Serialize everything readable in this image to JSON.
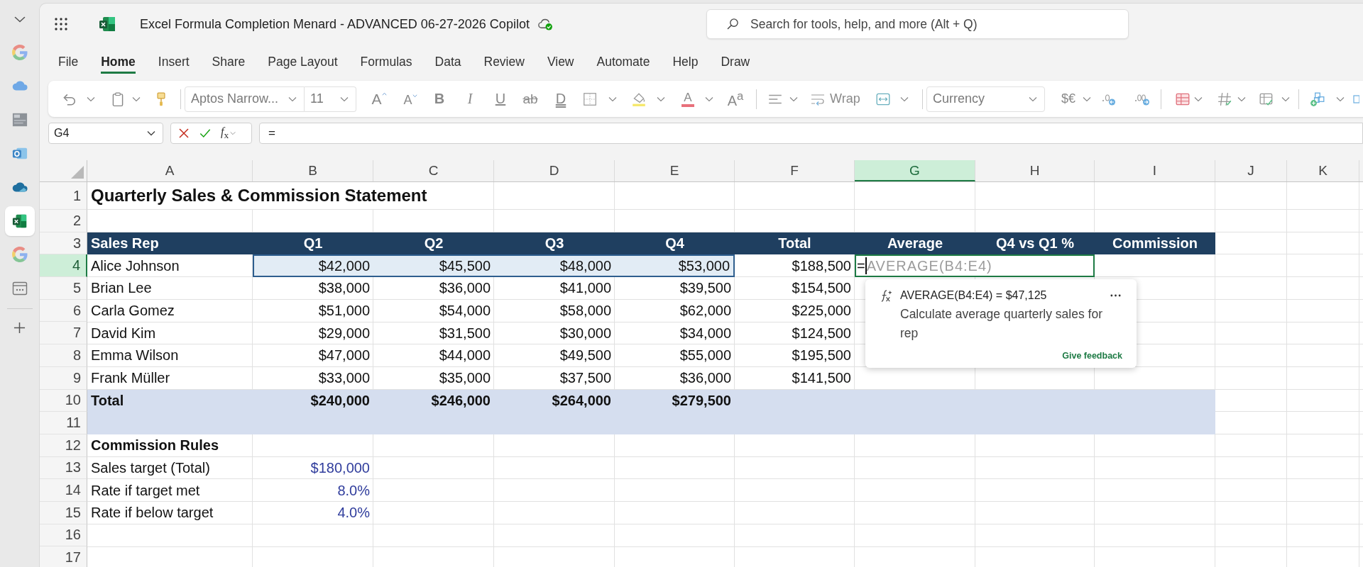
{
  "app_rail": {
    "apps": [
      {
        "selected": false
      },
      {
        "selected": false
      },
      {
        "selected": false
      },
      {
        "selected": false
      },
      {
        "selected": false
      },
      {
        "selected": true
      },
      {
        "selected": false
      },
      {
        "selected": false
      }
    ]
  },
  "title_bar": {
    "title": "Excel Formula Completion Menard - ADVANCED 06-27-2026 Copilot",
    "search": {
      "placeholder": "Search for tools, help, and more (Alt + Q)"
    }
  },
  "ribbon_tabs": [
    {
      "label": "File",
      "selected": false
    },
    {
      "label": "Home",
      "selected": true
    },
    {
      "label": "Insert",
      "selected": false
    },
    {
      "label": "Share",
      "selected": false
    },
    {
      "label": "Page Layout",
      "selected": false
    },
    {
      "label": "Formulas",
      "selected": false
    },
    {
      "label": "Data",
      "selected": false
    },
    {
      "label": "Review",
      "selected": false
    },
    {
      "label": "View",
      "selected": false
    },
    {
      "label": "Automate",
      "selected": false
    },
    {
      "label": "Help",
      "selected": false
    },
    {
      "label": "Draw",
      "selected": false
    }
  ],
  "ribbon": {
    "font_name": "Aptos Narrow...",
    "font_size": "11",
    "grow_font": "A",
    "shrink_font": "A",
    "bold": "B",
    "italic": "I",
    "underline": "U",
    "strikethrough": "ab",
    "double_underline": "D",
    "font_color": "A",
    "text_effects": "A$^{a}$",
    "wrap": "Wrap",
    "number_format": "Currency",
    "currency_symbols": "$€"
  },
  "formula_bar": {
    "name_box": "G4",
    "function_button": "*f*$_{x}$",
    "formula": "="
  },
  "sheet": {
    "columns": [
      {
        "label": "A",
        "selected": false
      },
      {
        "label": "B",
        "selected": false
      },
      {
        "label": "C",
        "selected": false
      },
      {
        "label": "D",
        "selected": false
      },
      {
        "label": "E",
        "selected": false
      },
      {
        "label": "F",
        "selected": false
      },
      {
        "label": "G",
        "selected": true
      },
      {
        "label": "H",
        "selected": false
      },
      {
        "label": "I",
        "selected": false
      },
      {
        "label": "J",
        "selected": false
      },
      {
        "label": "K",
        "selected": false
      }
    ],
    "rows": [
      {
        "number": "1",
        "selected": false,
        "kind": "title",
        "cells": [
          {
            "text": "Quarterly Sales & Commission Statement",
            "referenced": false
          }
        ]
      },
      {
        "number": "2",
        "selected": false,
        "kind": "blank"
      },
      {
        "number": "3",
        "selected": false,
        "kind": "header",
        "cells": [
          {
            "text": "Sales Rep",
            "referenced": false
          },
          {
            "text": "Q1",
            "referenced": false
          },
          {
            "text": "Q2",
            "referenced": false
          },
          {
            "text": "Q3",
            "referenced": false
          },
          {
            "text": "Q4",
            "referenced": false
          },
          {
            "text": "Total",
            "referenced": false
          },
          {
            "text": "Average",
            "referenced": false
          },
          {
            "text": "Q4 vs Q1 %",
            "referenced": false
          },
          {
            "text": "Commission",
            "referenced": false
          }
        ]
      },
      {
        "number": "4",
        "selected": true,
        "kind": "data",
        "cells": [
          {
            "text": "Alice Johnson",
            "referenced": false
          },
          {
            "text": "$42,000",
            "referenced": true
          },
          {
            "text": "$45,500",
            "referenced": true
          },
          {
            "text": "$48,000",
            "referenced": true
          },
          {
            "text": "$53,000",
            "referenced": true
          },
          {
            "text": "$188,500",
            "referenced": false
          }
        ],
        "editor": {
          "value": "=",
          "ghost_text": "AVERAGE(B4:E4)"
        }
      },
      {
        "number": "5",
        "selected": false,
        "kind": "data",
        "cells": [
          {
            "text": "Brian Lee",
            "referenced": false
          },
          {
            "text": "$38,000",
            "referenced": false
          },
          {
            "text": "$36,000",
            "referenced": false
          },
          {
            "text": "$41,000",
            "referenced": false
          },
          {
            "text": "$39,500",
            "referenced": false
          },
          {
            "text": "$154,500",
            "referenced": false
          }
        ]
      },
      {
        "number": "6",
        "selected": false,
        "kind": "data",
        "cells": [
          {
            "text": "Carla Gomez",
            "referenced": false
          },
          {
            "text": "$51,000",
            "referenced": false
          },
          {
            "text": "$54,000",
            "referenced": false
          },
          {
            "text": "$58,000",
            "referenced": false
          },
          {
            "text": "$62,000",
            "referenced": false
          },
          {
            "text": "$225,000",
            "referenced": false
          }
        ]
      },
      {
        "number": "7",
        "selected": false,
        "kind": "data",
        "cells": [
          {
            "text": "David Kim",
            "referenced": false
          },
          {
            "text": "$29,000",
            "referenced": false
          },
          {
            "text": "$31,500",
            "referenced": false
          },
          {
            "text": "$30,000",
            "referenced": false
          },
          {
            "text": "$34,000",
            "referenced": false
          },
          {
            "text": "$124,500",
            "referenced": false
          }
        ]
      },
      {
        "number": "8",
        "selected": false,
        "kind": "data",
        "cells": [
          {
            "text": "Emma Wilson",
            "referenced": false
          },
          {
            "text": "$47,000",
            "referenced": false
          },
          {
            "text": "$44,000",
            "referenced": false
          },
          {
            "text": "$49,500",
            "referenced": false
          },
          {
            "text": "$55,000",
            "referenced": false
          },
          {
            "text": "$195,500",
            "referenced": false
          }
        ]
      },
      {
        "number": "9",
        "selected": false,
        "kind": "data",
        "cells": [
          {
            "text": "Frank Müller",
            "referenced": false
          },
          {
            "text": "$33,000",
            "referenced": false
          },
          {
            "text": "$35,000",
            "referenced": false
          },
          {
            "text": "$37,500",
            "referenced": false
          },
          {
            "text": "$36,000",
            "referenced": false
          },
          {
            "text": "$141,500",
            "referenced": false
          }
        ]
      },
      {
        "number": "10",
        "selected": false,
        "kind": "total",
        "cells": [
          {
            "text": "Total",
            "referenced": false
          },
          {
            "text": "$240,000",
            "referenced": false
          },
          {
            "text": "$246,000",
            "referenced": false
          },
          {
            "text": "$264,000",
            "referenced": false
          },
          {
            "text": "$279,500",
            "referenced": false
          }
        ]
      },
      {
        "number": "11",
        "selected": false,
        "kind": "band"
      },
      {
        "number": "12",
        "selected": false,
        "kind": "section",
        "cells": [
          {
            "text": "Commission Rules",
            "referenced": false
          }
        ]
      },
      {
        "number": "13",
        "selected": false,
        "kind": "input",
        "cells": [
          {
            "text": "Sales target (Total)",
            "referenced": false
          },
          {
            "text": "$180,000",
            "referenced": false
          }
        ]
      },
      {
        "number": "14",
        "selected": false,
        "kind": "input",
        "cells": [
          {
            "text": "Rate if target met",
            "referenced": false
          },
          {
            "text": "8.0%",
            "referenced": false
          }
        ]
      },
      {
        "number": "15",
        "selected": false,
        "kind": "input",
        "cells": [
          {
            "text": "Rate if below target",
            "referenced": false
          },
          {
            "text": "4.0%",
            "referenced": false
          }
        ]
      },
      {
        "number": "16",
        "selected": false,
        "kind": "blank"
      },
      {
        "number": "17",
        "selected": false,
        "kind": "blank"
      }
    ],
    "suggestion_card": {
      "formula": "AVERAGE(B4:E4) = $47,125",
      "description": "Calculate average quarterly sales for rep",
      "feedback_link": "Give feedback"
    }
  }
}
